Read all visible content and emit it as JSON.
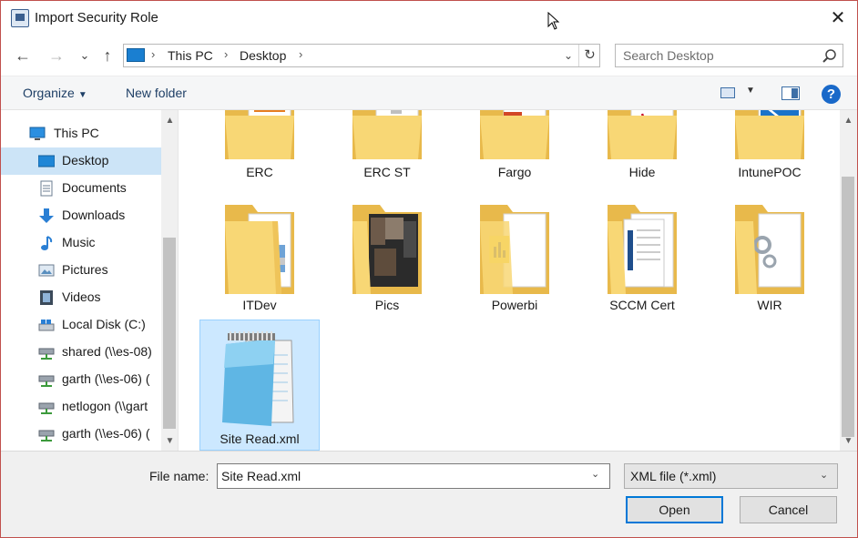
{
  "window": {
    "title": "Import Security Role",
    "close_glyph": "✕"
  },
  "nav": {
    "back_glyph": "←",
    "forward_glyph": "→",
    "recent_glyph": "⌄",
    "up_glyph": "↑",
    "breadcrumb": [
      "This PC",
      "Desktop"
    ],
    "separator": "›",
    "dropdown_glyph": "⌄",
    "refresh_glyph": "↻"
  },
  "search": {
    "placeholder": "Search Desktop"
  },
  "toolbar": {
    "organize_label": "Organize",
    "organize_caret": "▼",
    "new_folder_label": "New folder",
    "view_caret": "▼",
    "help_glyph": "?"
  },
  "sidebar": {
    "items": [
      {
        "label": "This PC",
        "icon": "this-pc-icon",
        "selected": false
      },
      {
        "label": "Desktop",
        "icon": "desktop-icon",
        "selected": true
      },
      {
        "label": "Documents",
        "icon": "documents-icon",
        "selected": false
      },
      {
        "label": "Downloads",
        "icon": "downloads-icon",
        "selected": false
      },
      {
        "label": "Music",
        "icon": "music-icon",
        "selected": false
      },
      {
        "label": "Pictures",
        "icon": "pictures-icon",
        "selected": false
      },
      {
        "label": "Videos",
        "icon": "videos-icon",
        "selected": false
      },
      {
        "label": "Local Disk (C:)",
        "icon": "local-disk-icon",
        "selected": false
      },
      {
        "label": "shared (\\\\es-08)",
        "icon": "network-drive-icon",
        "selected": false
      },
      {
        "label": "garth (\\\\es-06) (",
        "icon": "network-drive-icon",
        "selected": false
      },
      {
        "label": "netlogon (\\\\gart",
        "icon": "network-drive-icon",
        "selected": false
      },
      {
        "label": "garth (\\\\es-06) (",
        "icon": "network-drive-icon",
        "selected": false
      }
    ],
    "scroll_up_glyph": "▲",
    "scroll_down_glyph": "▼"
  },
  "files": {
    "row1": [
      {
        "label": "ERC",
        "overlay": "document"
      },
      {
        "label": "ERC ST",
        "overlay": "document"
      },
      {
        "label": "Fargo",
        "overlay": "powerpoint"
      },
      {
        "label": "Hide",
        "overlay": "pdf"
      },
      {
        "label": "IntunePOC",
        "overlay": "powershell"
      }
    ],
    "row2": [
      {
        "label": "ITDev",
        "overlay": "document"
      },
      {
        "label": "Pics",
        "overlay": "photos"
      },
      {
        "label": "Powerbi",
        "overlay": "powerbi"
      },
      {
        "label": "SCCM Cert",
        "overlay": "document"
      },
      {
        "label": "WIR",
        "overlay": "gears"
      }
    ],
    "row3": [
      {
        "label": "Site Read.xml",
        "overlay": "notepad",
        "selected": true
      }
    ]
  },
  "footer": {
    "filename_label": "File name:",
    "filename_value": "Site Read.xml",
    "filename_caret": "⌄",
    "filetype_value": "XML file (*.xml)",
    "filetype_caret": "⌄",
    "open_label": "Open",
    "cancel_label": "Cancel"
  },
  "colors": {
    "accent": "#0078d7",
    "selection": "#cce4f7",
    "folder": "#f8d775",
    "help": "#1969c9"
  }
}
